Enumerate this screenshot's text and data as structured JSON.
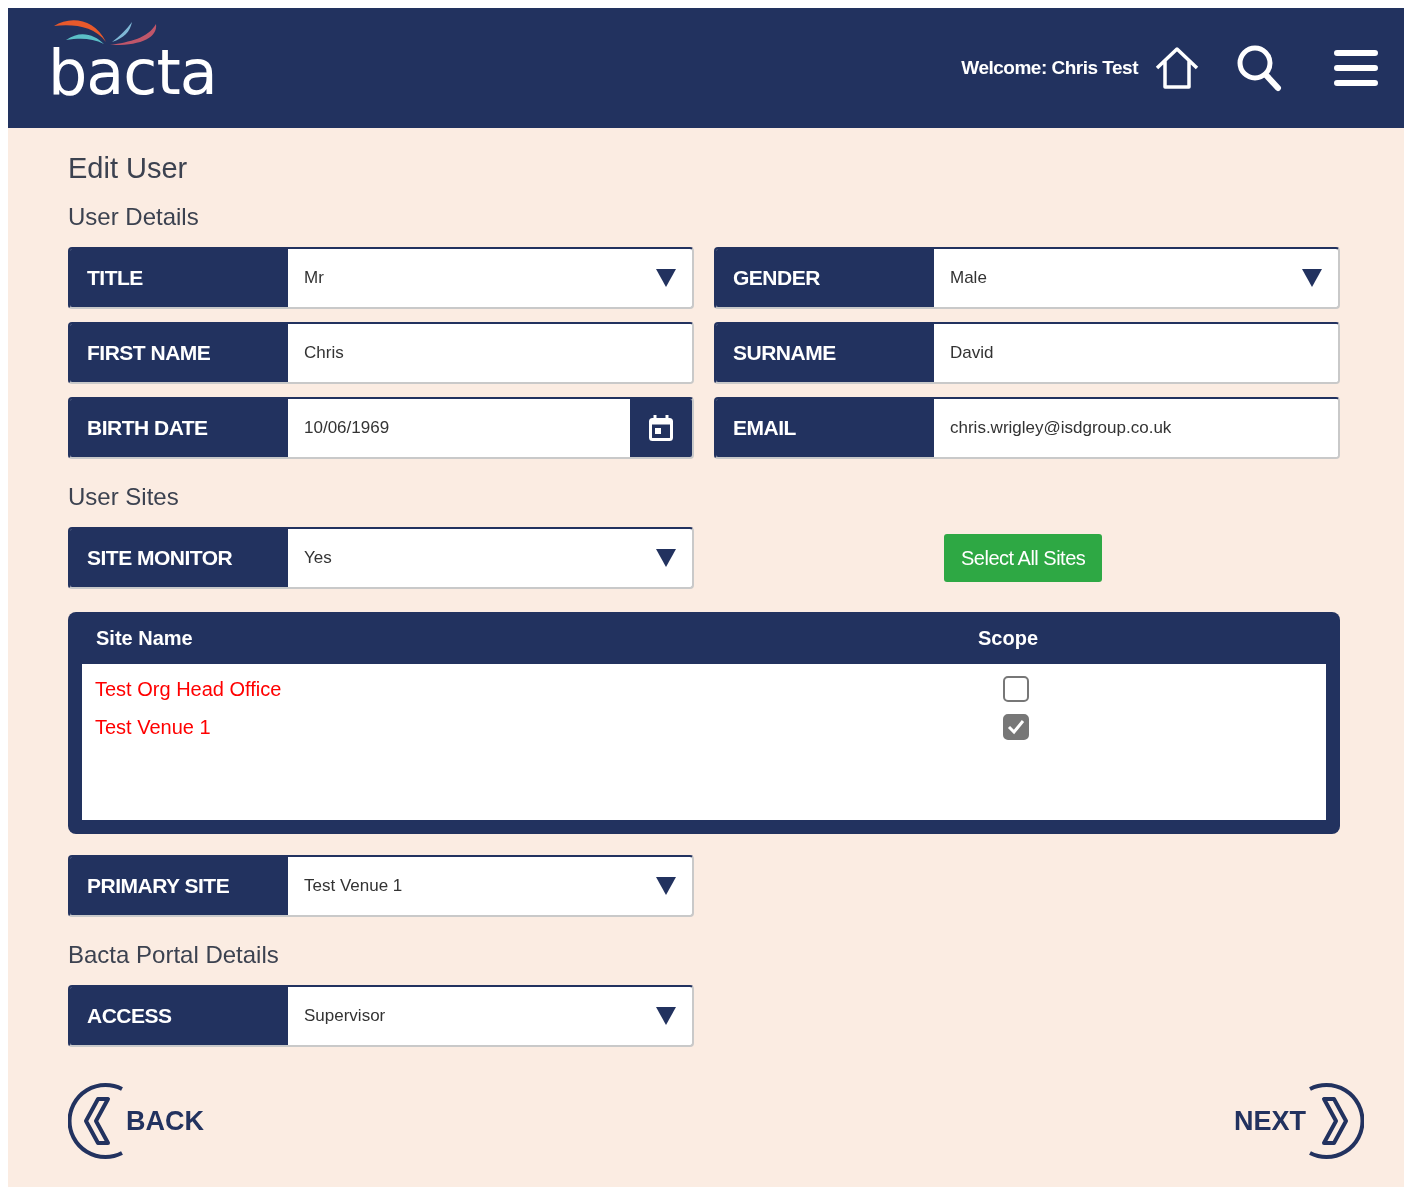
{
  "header": {
    "logo": "bacta",
    "welcome": "Welcome: Chris Test"
  },
  "page_title": "Edit User",
  "user_details": {
    "heading": "User Details",
    "fields": [
      {
        "label": "TITLE",
        "value": "Mr",
        "kind": "select"
      },
      {
        "label": "GENDER",
        "value": "Male",
        "kind": "select"
      },
      {
        "label": "FIRST NAME",
        "value": "Chris",
        "kind": "text"
      },
      {
        "label": "SURNAME",
        "value": "David",
        "kind": "text"
      },
      {
        "label": "BIRTH DATE",
        "value": "10/06/1969",
        "kind": "date"
      },
      {
        "label": "EMAIL",
        "value": "chris.wrigley@isdgroup.co.uk",
        "kind": "text"
      }
    ]
  },
  "user_sites": {
    "heading": "User Sites",
    "site_monitor": {
      "label": "SITE MONITOR",
      "value": "Yes",
      "kind": "select"
    },
    "select_all_button": "Select All Sites",
    "table": {
      "columns": [
        "Site Name",
        "Scope"
      ],
      "rows": [
        {
          "site_name": "Test Org Head Office",
          "checked": false
        },
        {
          "site_name": "Test Venue 1",
          "checked": true
        }
      ]
    },
    "primary_site": {
      "label": "PRIMARY SITE",
      "value": "Test Venue 1",
      "kind": "select"
    }
  },
  "portal_details": {
    "heading": "Bacta Portal Details",
    "fields": [
      {
        "label": "ACCESS",
        "value": "Supervisor",
        "kind": "select"
      }
    ]
  },
  "nav": {
    "back": "BACK",
    "next": "NEXT"
  }
}
